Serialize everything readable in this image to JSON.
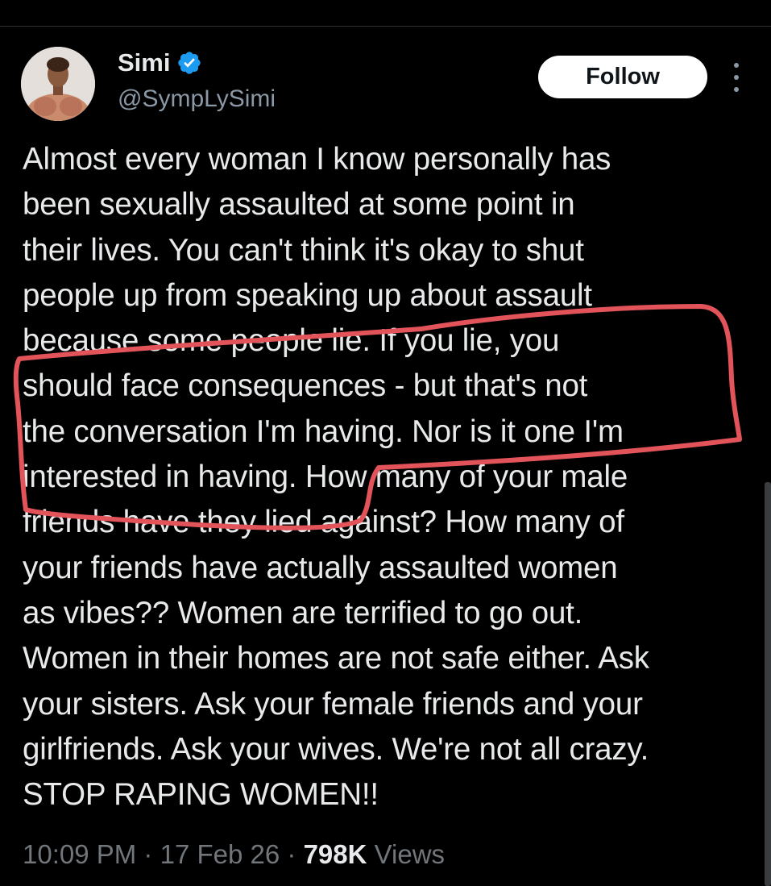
{
  "colors": {
    "background": "#000000",
    "text": "#e7e9ea",
    "secondary_text": "#71767b",
    "verified_badge": "#1d9bf0",
    "follow_bg": "#ffffff",
    "annotation_red": "#e2545a"
  },
  "author": {
    "name": "Simi",
    "handle": "@SympLySimi",
    "verified": true,
    "avatar_icon": "profile-photo"
  },
  "actions": {
    "follow_label": "Follow",
    "more_icon": "more-vertical-icon"
  },
  "tweet": {
    "lines": [
      "Almost every woman I know personally has",
      "been sexually assaulted at some point in",
      "their lives. You can't think it's okay to shut",
      "people up from speaking up about assault",
      "because some people lie. If you lie, you",
      "should face consequences - but that's not",
      "the conversation I'm having. Nor is it one I'm",
      "interested in having. How many of your male",
      "friends have they lied against? How many of",
      "your friends have actually assaulted women",
      "as vibes?? Women are terrified to go out.",
      "Women in their homes are not safe either. Ask",
      "your sisters. Ask your female friends and your",
      "girlfriends. Ask your wives. We're not all crazy.",
      "STOP RAPING WOMEN!!"
    ]
  },
  "meta": {
    "time": "10:09 PM",
    "separator": "·",
    "date": "17 Feb 26",
    "views_count": "798K",
    "views_label": "Views"
  }
}
